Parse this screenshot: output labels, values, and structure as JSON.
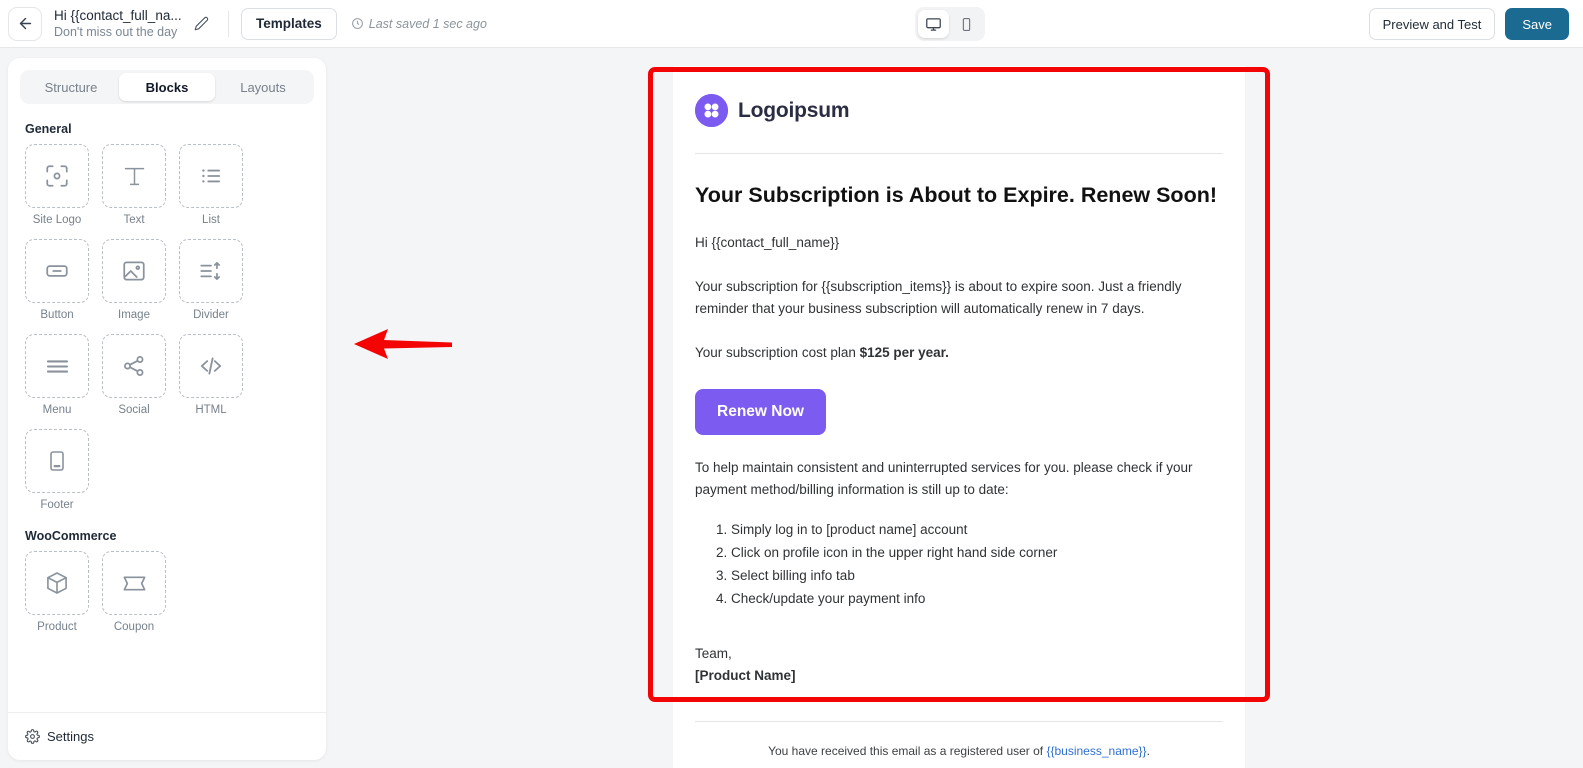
{
  "topbar": {
    "back_icon": "arrow-left-icon",
    "title": "Hi {{contact_full_na...",
    "subtitle": "Don't miss out the day",
    "pencil_icon": "pencil-edit-icon",
    "templates_label": "Templates",
    "clock_icon": "clock-icon",
    "saved_status": "Last saved 1 sec ago",
    "devices": [
      {
        "name": "desktop-view",
        "icon": "monitor-icon",
        "active": true
      },
      {
        "name": "mobile-view",
        "icon": "mobile-icon",
        "active": false
      }
    ],
    "preview_label": "Preview and Test",
    "save_label": "Save",
    "save_color": "#1b6a92"
  },
  "sidebar": {
    "tabs": [
      {
        "label": "Structure",
        "active": false
      },
      {
        "label": "Blocks",
        "active": true
      },
      {
        "label": "Layouts",
        "active": false
      }
    ],
    "groups": [
      {
        "title": "General",
        "blocks": [
          {
            "label": "Site Logo",
            "icon": "site-logo-icon"
          },
          {
            "label": "Text",
            "icon": "text-icon"
          },
          {
            "label": "List",
            "icon": "list-icon"
          },
          {
            "label": "Button",
            "icon": "button-icon"
          },
          {
            "label": "Image",
            "icon": "image-icon"
          },
          {
            "label": "Divider",
            "icon": "divider-icon"
          },
          {
            "label": "Menu",
            "icon": "menu-icon"
          },
          {
            "label": "Social",
            "icon": "social-share-icon"
          },
          {
            "label": "HTML",
            "icon": "code-icon"
          },
          {
            "label": "Footer",
            "icon": "footer-icon"
          }
        ]
      },
      {
        "title": "WooCommerce",
        "blocks": [
          {
            "label": "Product",
            "icon": "product-box-icon"
          },
          {
            "label": "Coupon",
            "icon": "coupon-ticket-icon"
          }
        ]
      }
    ],
    "settings_label": "Settings",
    "settings_icon": "gear-icon"
  },
  "email": {
    "logo_text": "Logoipsum",
    "logo_color": "#7c5cf0",
    "heading": "Your Subscription is About to Expire. Renew Soon!",
    "greeting": "Hi {{contact_full_name}}",
    "paragraph_1": "Your subscription for {{subscription_items}} is about to expire soon. Just a friendly reminder that your business subscription will automatically renew in 7 days.",
    "cost_prefix": "Your subscription cost plan ",
    "cost_amount": "$125 per year.",
    "cta_label": "Renew Now",
    "cta_color": "#7c5cf0",
    "paragraph_2": "To help maintain consistent and uninterrupted services for you. please check if your payment method/billing information is still up to date:",
    "steps": [
      "Simply log in to [product name] account",
      "Click on profile icon in the upper right hand side corner",
      "Select billing info tab",
      "Check/update your payment info"
    ],
    "sign_off": "Team,",
    "sign_name": "[Product Name]",
    "footer_prefix": "You have received this email as a registered user of ",
    "footer_link": "{{business_name}}",
    "footer_suffix": "."
  },
  "annotations": {
    "highlight_color": "#f40505",
    "arrow_direction": "left",
    "arrow_color": "#f40505"
  }
}
